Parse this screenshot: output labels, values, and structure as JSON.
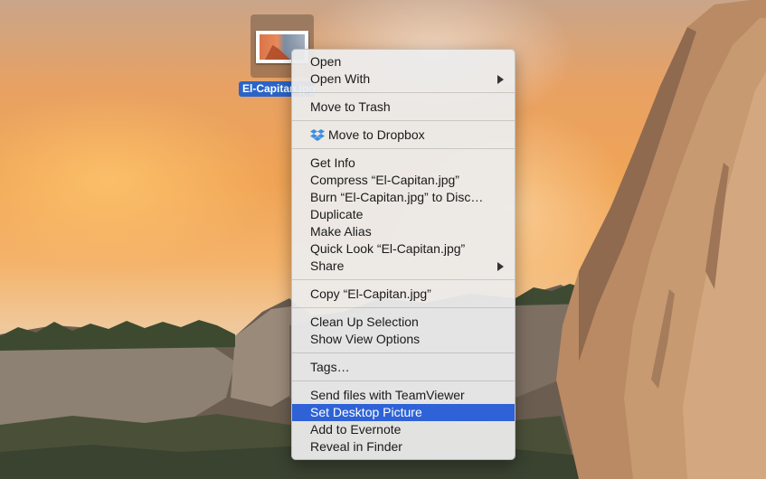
{
  "desktop": {
    "file_name": "El-Capitan.jpg",
    "file_label": "El-Capitan.jpg"
  },
  "menu": {
    "groups": [
      [
        {
          "label": "Open"
        },
        {
          "label": "Open With",
          "submenu": true
        }
      ],
      [
        {
          "label": "Move to Trash"
        }
      ],
      [
        {
          "label": "Move to Dropbox",
          "icon": "dropbox-icon"
        }
      ],
      [
        {
          "label": "Get Info"
        },
        {
          "label": "Compress “El-Capitan.jpg”"
        },
        {
          "label": "Burn “El-Capitan.jpg” to Disc…"
        },
        {
          "label": "Duplicate"
        },
        {
          "label": "Make Alias"
        },
        {
          "label": "Quick Look “El-Capitan.jpg”"
        },
        {
          "label": "Share",
          "submenu": true
        }
      ],
      [
        {
          "label": "Copy “El-Capitan.jpg”"
        }
      ],
      [
        {
          "label": "Clean Up Selection"
        },
        {
          "label": "Show View Options"
        }
      ],
      [
        {
          "label": "Tags…"
        }
      ],
      [
        {
          "label": "Send files with TeamViewer"
        },
        {
          "label": "Set Desktop Picture",
          "selected": true
        },
        {
          "label": "Add to Evernote"
        },
        {
          "label": "Reveal in Finder"
        }
      ]
    ]
  },
  "colors": {
    "selection": "#2f62d6",
    "file_label_bg": "#2b64c9"
  }
}
